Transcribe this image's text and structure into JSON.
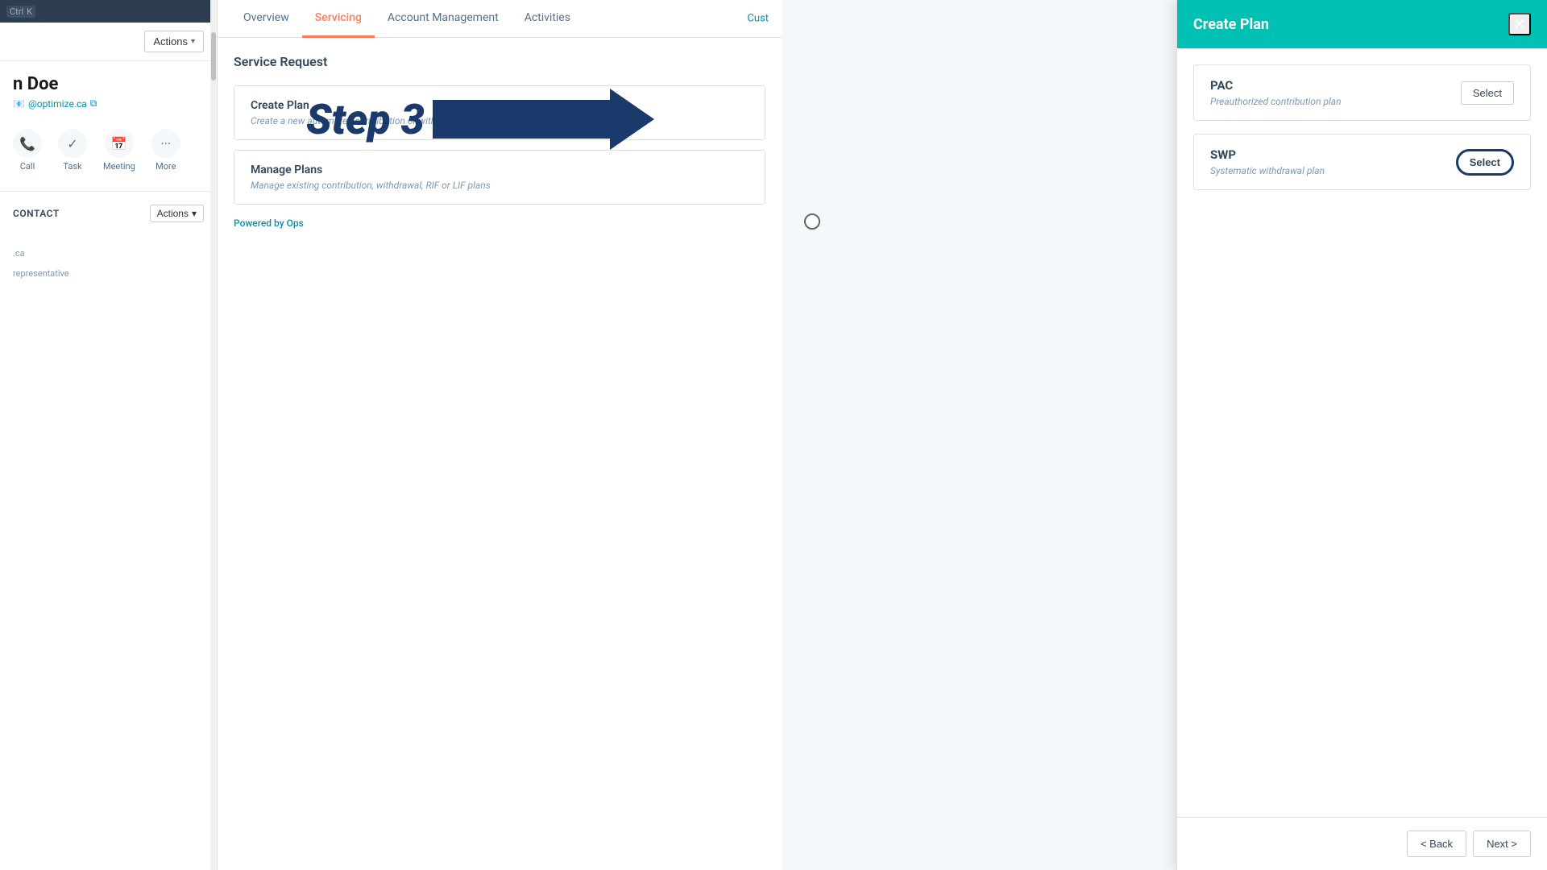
{
  "topbar": {
    "kbd_ctrl": "Ctrl",
    "kbd_k": "K"
  },
  "sidebar": {
    "actions_label": "Actions",
    "contact_name": "n Doe",
    "contact_email": "@optimize.ca",
    "contact_email_icon": "📧",
    "actions": [
      {
        "label": "Call",
        "icon": "📞"
      },
      {
        "label": "Task",
        "icon": "✓"
      },
      {
        "label": "Meeting",
        "icon": "📅"
      },
      {
        "label": "More",
        "icon": "···"
      }
    ],
    "section_title": "Contact",
    "actions2_label": "Actions",
    "footer_text": ".ca",
    "representative_label": "representative"
  },
  "tabs": [
    {
      "label": "Overview",
      "active": false
    },
    {
      "label": "Servicing",
      "active": true
    },
    {
      "label": "Account Management",
      "active": false
    },
    {
      "label": "Activities",
      "active": false
    }
  ],
  "cust_btn": "Cust",
  "main": {
    "section_title": "Service Request",
    "cards": [
      {
        "title": "Create Plan",
        "desc": "Create a new automated contribution or withdrawal plan"
      },
      {
        "title": "Manage Plans",
        "desc": "Manage existing contribution, withdrawal, RIF or LIF plans"
      }
    ],
    "powered_by_prefix": "Powered by ",
    "powered_by_brand": "Ops"
  },
  "step3": {
    "label": "Step 3"
  },
  "panel": {
    "title": "Create Plan",
    "close_icon": "✕",
    "options": [
      {
        "name": "PAC",
        "desc": "Preauthorized contribution plan",
        "btn_label": "Select",
        "highlighted": false
      },
      {
        "name": "SWP",
        "desc": "Systematic withdrawal plan",
        "btn_label": "Select",
        "highlighted": true
      }
    ],
    "footer": {
      "back_label": "< Back",
      "next_label": "Next >"
    }
  }
}
